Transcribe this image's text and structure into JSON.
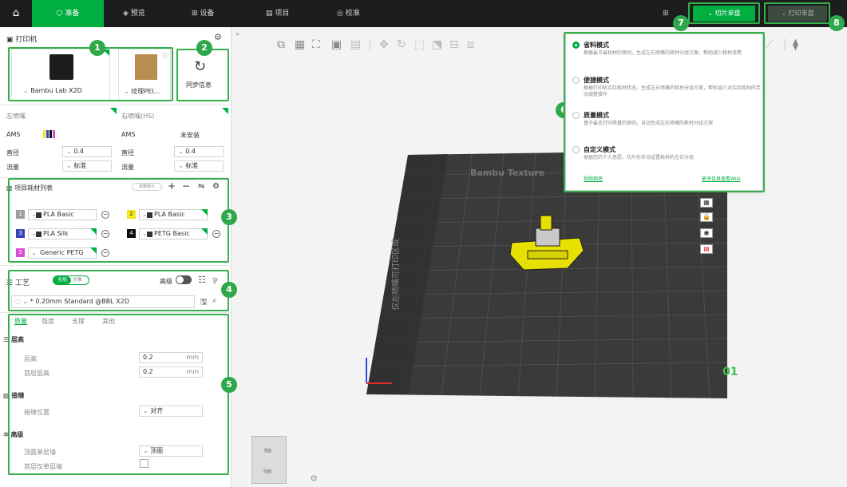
{
  "topbar": {
    "tabs": [
      "准备",
      "预览",
      "设备",
      "项目",
      "校准"
    ],
    "slice_label": "切片单盘",
    "print_label": "打印单盘"
  },
  "printer_section": {
    "title": "打印机",
    "printer_name": "Bambu Lab X2D",
    "plate_name": "纹理PEI...",
    "sync_label": "同步信息"
  },
  "nozzles": {
    "left": {
      "title": "左喷嘴",
      "ams_label": "AMS",
      "diameter_label": "直径",
      "diameter_value": "0.4",
      "flow_label": "流量",
      "flow_value": "标准"
    },
    "right": {
      "title": "右喷嘴(HS)",
      "ams_label": "AMS",
      "ams_value": "未安装",
      "diameter_label": "直径",
      "diameter_value": "0.4",
      "flow_label": "流量",
      "flow_value": "标准"
    }
  },
  "filaments": {
    "title": "项目耗材列表",
    "badge": "米数统计",
    "items": [
      {
        "num": "1",
        "name": "PLA Basic",
        "color": "#9e9e9e"
      },
      {
        "num": "2",
        "name": "PLA Basic",
        "color": "#f4e61a"
      },
      {
        "num": "3",
        "name": "PLA Silk",
        "color": "#3a45b8"
      },
      {
        "num": "4",
        "name": "PETG Basic",
        "color": "#111111"
      },
      {
        "num": "5",
        "name": "Generic PETG",
        "color": "#d94fd0"
      }
    ]
  },
  "process": {
    "title": "工艺",
    "toggle_global": "全局",
    "toggle_object": "对象",
    "advanced_label": "高级",
    "preset": "* 0.20mm Standard @BBL X2D"
  },
  "settings": {
    "tabs": [
      "质量",
      "强度",
      "支撑",
      "其他"
    ],
    "groups": [
      {
        "title": "层高",
        "rows": [
          {
            "label": "层高",
            "value": "0.2",
            "unit": "mm"
          },
          {
            "label": "首层层高",
            "value": "0.2",
            "unit": "mm"
          }
        ]
      },
      {
        "title": "接缝",
        "rows": [
          {
            "label": "接缝位置",
            "value": "对齐",
            "unit": ""
          }
        ]
      },
      {
        "title": "高级",
        "rows": [
          {
            "label": "顶面单层墙",
            "value": "顶面",
            "unit": ""
          },
          {
            "label": "首层仅单层墙",
            "value": "",
            "unit": ""
          }
        ]
      }
    ]
  },
  "plate": {
    "brand_text": "Bambu Texture",
    "side_text": "仅左喷嘴可打印区域",
    "plate_number": "01"
  },
  "popup": {
    "modes": [
      {
        "title": "省料模式",
        "desc": "根据最节省耗材的原则，生成左右喷嘴的耗材分组方案，帮助减少耗材浪费",
        "selected": true
      },
      {
        "title": "便捷模式",
        "desc": "根据打印机实际耗材状态，生成左右喷嘴的耗材分组方案，帮助减少对实际耗材的手动调整操作",
        "selected": false
      },
      {
        "title": "质量模式",
        "desc": "基于最优打印质量的原则，自动生成左右喷嘴的耗材分组方案",
        "selected": false
      },
      {
        "title": "自定义模式",
        "desc": "根据您的个人意愿，切片前手动设置耗材的左右分组",
        "selected": false
      }
    ],
    "link_video": "视频指南",
    "link_wiki": "更多信息查看Wiki"
  },
  "callouts": [
    "1",
    "2",
    "3",
    "4",
    "5",
    "6",
    "7",
    "8"
  ],
  "nav_cube": {
    "top": "顶面",
    "front": "前面"
  },
  "colors": {
    "accent": "#00ae42",
    "highlight": "#35b04a",
    "topbar": "#1b1d1f"
  },
  "icons": [
    "home-icon",
    "cube-icon",
    "settings-icon",
    "sync-icon",
    "gear-icon",
    "plus-icon",
    "minus-icon",
    "list-icon"
  ]
}
